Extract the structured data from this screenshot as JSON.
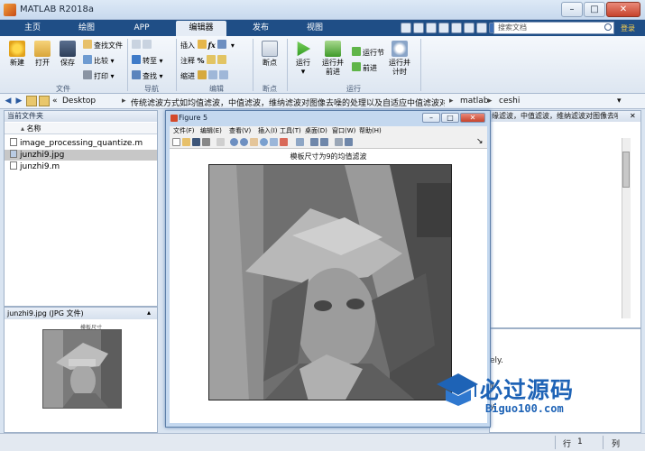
{
  "window": {
    "title": "MATLAB R2018a",
    "min": "–",
    "max": "□",
    "close": "✕"
  },
  "tabs": [
    {
      "label": "主页",
      "active": false
    },
    {
      "label": "绘图",
      "active": false
    },
    {
      "label": "APP",
      "active": false
    },
    {
      "label": "编辑器",
      "active": true
    },
    {
      "label": "发布",
      "active": false
    },
    {
      "label": "视图",
      "active": false
    }
  ],
  "search": {
    "placeholder": "搜索文档"
  },
  "community_label": "登录",
  "ribbon": {
    "file": {
      "new": "新建",
      "open": "打开",
      "save": "保存",
      "find_files": "查找文件",
      "compare": "比较",
      "print": "打印",
      "group": "文件"
    },
    "navigate": {
      "goto": "转至",
      "find": "查找",
      "group": "导航"
    },
    "edit": {
      "insert": "插入",
      "comment": "注释",
      "indent": "缩进",
      "group": "编辑"
    },
    "breakpoints": {
      "breakpoints": "断点",
      "group": "断点"
    },
    "run": {
      "run": "运行",
      "run_advance": "运行并\n前进",
      "run_section": "运行节",
      "advance": "前进",
      "run_time": "运行并\n计时",
      "group": "运行"
    }
  },
  "address": {
    "prefix": "«",
    "crumbs": [
      "Desktop",
      "传统滤波方式如均值滤波，中值滤波，维纳滤波对图像去噪的处理以及自适应中值滤波对图像去噪",
      "matlab",
      "ceshi"
    ]
  },
  "current_folder": {
    "title": "当前文件夹",
    "column": "名称",
    "files": [
      {
        "name": "image_processing_quantize.m",
        "selected": false
      },
      {
        "name": "junzhi9.jpg",
        "selected": true
      },
      {
        "name": "junzhi9.m",
        "selected": false
      }
    ]
  },
  "details": {
    "title": "junzhi9.jpg  (JPG 文件)",
    "thumb_caption": "模板尺寸"
  },
  "editor_panel": {
    "title": "缘滤波，中值滤波，维纳滤波对图像去噪的处理..."
  },
  "command_window": {
    "line1": "ely.",
    "line2": "y.",
    "line3": "y."
  },
  "figure": {
    "title": "Figure 5",
    "menus": [
      "文件(F)",
      "编辑(E)",
      "查看(V)",
      "插入(I)",
      "工具(T)",
      "桌面(D)",
      "窗口(W)",
      "帮助(H)"
    ],
    "plot_title": "模板尺寸为9的均值滤波"
  },
  "watermark": {
    "text": "必过源码",
    "url": "Biguo100.com"
  },
  "status": {
    "row_label": "行",
    "row": "1",
    "col_label": "列"
  }
}
